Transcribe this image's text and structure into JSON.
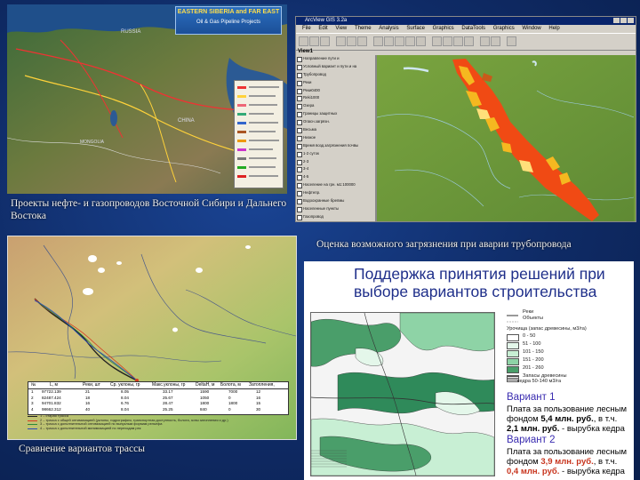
{
  "slide": {
    "caption_pipelines": "Проекты нефте- и газопроводов Восточной Сибири и Дальнего Востока",
    "caption_pollution": "Оценка возможного загрязнения при аварии трубопровода",
    "caption_routes": "Сравнение вариантов трассы"
  },
  "pipeline_map": {
    "title_line1": "EASTERN SIBERIA and FAR EAST",
    "title_line2": "Oil & Gas Pipeline Projects",
    "labels": {
      "russia": "RUSSIA",
      "china": "CHINA",
      "mongolia": "MONGOLIA"
    }
  },
  "gis_window": {
    "title": "ArcView GIS 3.2a",
    "menus": [
      "File",
      "Edit",
      "View",
      "Theme",
      "Analysis",
      "Surface",
      "Graphics",
      "DataTools",
      "Graphics",
      "Window",
      "Help"
    ],
    "view_label": "View1",
    "toc_items": [
      "Направление пути и",
      "Условный вариант и пути и на",
      "Трубопровод",
      "Реки",
      "Реки0400",
      "Reki1000",
      "Озера",
      "Границы защитных",
      "Опасн.загрязн.",
      "Весьма",
      "Низкое",
      "Время возд.загрязнения почвы",
      "1-2 суток",
      "2-3",
      "3-4",
      "4-5",
      "Население на грн. м1:100000",
      "Нефтепр.",
      "Водоохранные брепмы",
      "Населенные пункты",
      "Газопровод",
      "Лицензионный участок",
      "Эксплуатац. скважины",
      "Нефтяные скважины",
      "Буферные зоны",
      "Нефть",
      "Линии электропередач",
      "Охранная зона по",
      "Охранная зона по ЛЭП",
      "Экспл. скважины",
      "Kod5",
      "Relief_Raster",
      "1995.145 - 2240.086",
      "2240.086 - 2485.027",
      "1707.778 - 1950.148"
    ],
    "colors": {
      "terrain": "#6f9a3a",
      "hazard_high": "#f04a14",
      "hazard_mid": "#f5b820",
      "water": "#9ccbe0"
    }
  },
  "routes_table": {
    "headers": [
      "№",
      "L, м",
      "Реки, шт",
      "Ср. уклоны, гр",
      "Макс.уклоны, гр",
      "DeltaH, м",
      "Болота, м",
      "Затопления,"
    ],
    "rows": [
      [
        "1",
        "97722.139",
        "21",
        "8.05",
        "33.17",
        "1590",
        "7000",
        "12"
      ],
      [
        "2",
        "82487.424",
        "18",
        "8.04",
        "25.67",
        "1050",
        "0",
        "16"
      ],
      [
        "3",
        "94701.832",
        "16",
        "6.76",
        "28.47",
        "1800",
        "1800",
        "15"
      ],
      [
        "4",
        "98662.312",
        "40",
        "8.04",
        "25.25",
        "840",
        "0",
        "30"
      ]
    ],
    "notes": [
      "1 – старая трасса",
      "2 – трасса с общей оптимизацией (уклоны, гидрография, транспортная доступность, болота, зоны затопления и др.)",
      "3 – трасса с дополнительной оптимизацией по выпуклым формам рельефа",
      "4 – трасса с дополнительной минимизацией по переходам рек"
    ]
  },
  "decision_panel": {
    "title": "Поддержка принятия решений при выборе вариантов строительства",
    "legend": {
      "rivers": "Реки",
      "roads": "Объекты",
      "tracts_header": "Урочища (запас древесины, м3/га)",
      "classes": [
        "0 - 50",
        "51 - 100",
        "101 - 150",
        "151 - 200",
        "201 - 260"
      ],
      "cedar_line1": "Запасы древесины",
      "cedar_line2": "кедра 50-140 м3/га"
    },
    "variant1": {
      "title": "Вариант 1",
      "line1": "Плата за пользование лесным",
      "line2_a": "фондом",
      "line2_amount": "5,4 млн. руб.",
      "line2_b": ", в т.ч.",
      "line3_amount": "2,1 млн. руб.",
      "line3_b": " - вырубка кедра"
    },
    "variant2": {
      "title": "Вариант 2",
      "line1": "Плата за пользование лесным",
      "line2_a": "фондом",
      "line2_amount": "3,9 млн. руб.",
      "line2_b": ", в т.ч.",
      "line3_amount": "0,4 млн. руб.",
      "line3_b": " - вырубка кедра"
    }
  }
}
